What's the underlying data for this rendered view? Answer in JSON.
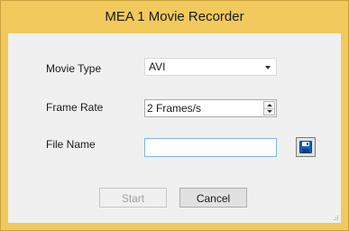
{
  "window": {
    "title": "MEA 1 Movie Recorder"
  },
  "form": {
    "movie_type_label": "Movie Type",
    "movie_type_value": "AVI",
    "frame_rate_label": "Frame Rate",
    "frame_rate_value": "2 Frames/s",
    "file_name_label": "File Name",
    "file_name_value": ""
  },
  "buttons": {
    "start_label": "Start",
    "cancel_label": "Cancel"
  },
  "icons": {
    "browse": "floppy-disk-icon",
    "dropdown": "chevron-down-icon",
    "spin_up": "spin-up-icon",
    "spin_down": "spin-down-icon",
    "resize": "resize-grip-icon"
  },
  "colors": {
    "title_bar": "#f1c95c",
    "client_bg": "#f0f0f0",
    "focus_border": "#7eb4ea",
    "save_icon": "#1c5fb0"
  }
}
